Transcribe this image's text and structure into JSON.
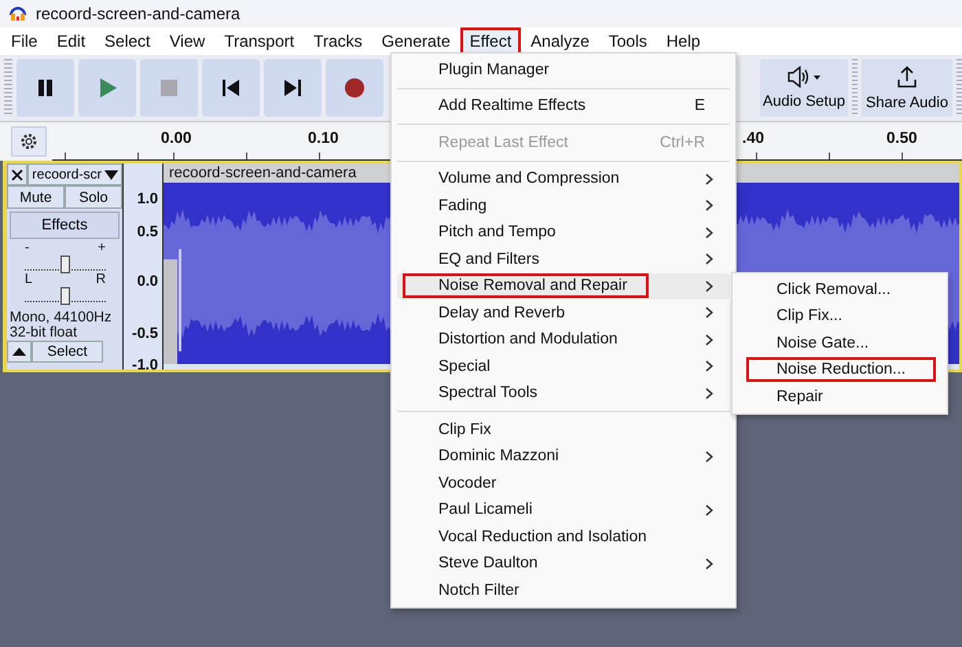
{
  "window": {
    "title": "recoord-screen-and-camera"
  },
  "menu_bar": [
    {
      "label": "File",
      "selected": false,
      "annotated": false
    },
    {
      "label": "Edit",
      "selected": false,
      "annotated": false
    },
    {
      "label": "Select",
      "selected": false,
      "annotated": false
    },
    {
      "label": "View",
      "selected": false,
      "annotated": false
    },
    {
      "label": "Transport",
      "selected": false,
      "annotated": false
    },
    {
      "label": "Tracks",
      "selected": false,
      "annotated": false
    },
    {
      "label": "Generate",
      "selected": false,
      "annotated": false
    },
    {
      "label": "Effect",
      "selected": true,
      "annotated": true
    },
    {
      "label": "Analyze",
      "selected": false,
      "annotated": false
    },
    {
      "label": "Tools",
      "selected": false,
      "annotated": false
    },
    {
      "label": "Help",
      "selected": false,
      "annotated": false
    }
  ],
  "toolbar": {
    "transport_buttons": [
      {
        "kind": "pause"
      },
      {
        "kind": "play"
      },
      {
        "kind": "stop"
      },
      {
        "kind": "skip_start"
      },
      {
        "kind": "skip_end"
      },
      {
        "kind": "record"
      }
    ],
    "audio_setup": {
      "label": "Audio Setup"
    },
    "share_audio": {
      "label": "Share Audio"
    }
  },
  "ruler": {
    "ticks": [
      "0.00",
      "0.10",
      ".40",
      "0.50"
    ]
  },
  "track": {
    "name": "recoord-scr",
    "clip_title": "recoord-screen-and-camera",
    "mute": "Mute",
    "solo": "Solo",
    "effects": "Effects",
    "gain": {
      "min_label": "-",
      "max_label": "+",
      "level": 0.5
    },
    "pan": {
      "min_label": "L",
      "max_label": "R",
      "level": 0.5
    },
    "info": [
      "Mono, 44100Hz",
      "32-bit float"
    ],
    "select": "Select",
    "scale": [
      "1.0",
      "0.5",
      "0.0",
      "-0.5",
      "-1.0"
    ]
  },
  "effect_menu": {
    "sections": [
      [
        {
          "label": "Plugin Manager",
          "submenu": false,
          "disabled": false,
          "selected": false,
          "annotated": false
        }
      ],
      [
        {
          "label": "Add Realtime Effects",
          "shortcut": "E",
          "submenu": false,
          "disabled": false,
          "selected": false,
          "annotated": false
        }
      ],
      [
        {
          "label": "Repeat Last Effect",
          "shortcut": "Ctrl+R",
          "submenu": false,
          "disabled": true,
          "selected": false,
          "annotated": false
        }
      ],
      [
        {
          "label": "Volume and Compression",
          "submenu": true,
          "disabled": false,
          "selected": false,
          "annotated": false
        },
        {
          "label": "Fading",
          "submenu": true,
          "disabled": false,
          "selected": false,
          "annotated": false
        },
        {
          "label": "Pitch and Tempo",
          "submenu": true,
          "disabled": false,
          "selected": false,
          "annotated": false
        },
        {
          "label": "EQ and Filters",
          "submenu": true,
          "disabled": false,
          "selected": false,
          "annotated": false
        },
        {
          "label": "Noise Removal and Repair",
          "submenu": true,
          "disabled": false,
          "selected": true,
          "annotated": true
        },
        {
          "label": "Delay and Reverb",
          "submenu": true,
          "disabled": false,
          "selected": false,
          "annotated": false
        },
        {
          "label": "Distortion and Modulation",
          "submenu": true,
          "disabled": false,
          "selected": false,
          "annotated": false
        },
        {
          "label": "Special",
          "submenu": true,
          "disabled": false,
          "selected": false,
          "annotated": false
        },
        {
          "label": "Spectral Tools",
          "submenu": true,
          "disabled": false,
          "selected": false,
          "annotated": false
        }
      ],
      [
        {
          "label": "Clip Fix",
          "submenu": false,
          "disabled": false,
          "selected": false,
          "annotated": false
        },
        {
          "label": "Dominic Mazzoni",
          "submenu": true,
          "disabled": false,
          "selected": false,
          "annotated": false
        },
        {
          "label": "Vocoder",
          "submenu": false,
          "disabled": false,
          "selected": false,
          "annotated": false
        },
        {
          "label": "Paul Licameli",
          "submenu": true,
          "disabled": false,
          "selected": false,
          "annotated": false
        },
        {
          "label": "Vocal Reduction and Isolation",
          "submenu": false,
          "disabled": false,
          "selected": false,
          "annotated": false
        },
        {
          "label": "Steve Daulton",
          "submenu": true,
          "disabled": false,
          "selected": false,
          "annotated": false
        },
        {
          "label": "Notch Filter",
          "submenu": false,
          "disabled": false,
          "selected": false,
          "annotated": false
        }
      ]
    ]
  },
  "submenu": {
    "items": [
      {
        "label": "Click Removal...",
        "annotated": false
      },
      {
        "label": "Clip Fix...",
        "annotated": false
      },
      {
        "label": "Noise Gate...",
        "annotated": false
      },
      {
        "label": "Noise Reduction...",
        "annotated": true
      },
      {
        "label": "Repair",
        "annotated": false
      }
    ]
  }
}
